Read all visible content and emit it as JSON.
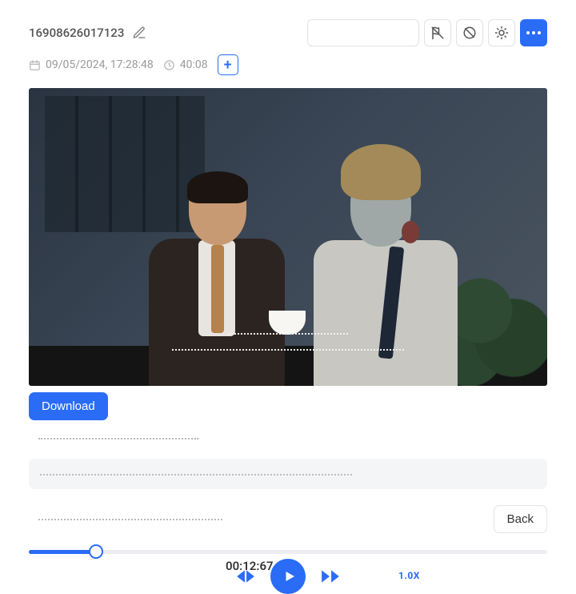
{
  "header": {
    "title": "16908626017123",
    "date": "09/05/2024, 17:28:48",
    "duration": "40:08"
  },
  "actions": {
    "download_label": "Download",
    "back_label": "Back"
  },
  "player": {
    "current_time": "00:12:67",
    "speed_label": "1.0X",
    "progress_percent": 13
  }
}
